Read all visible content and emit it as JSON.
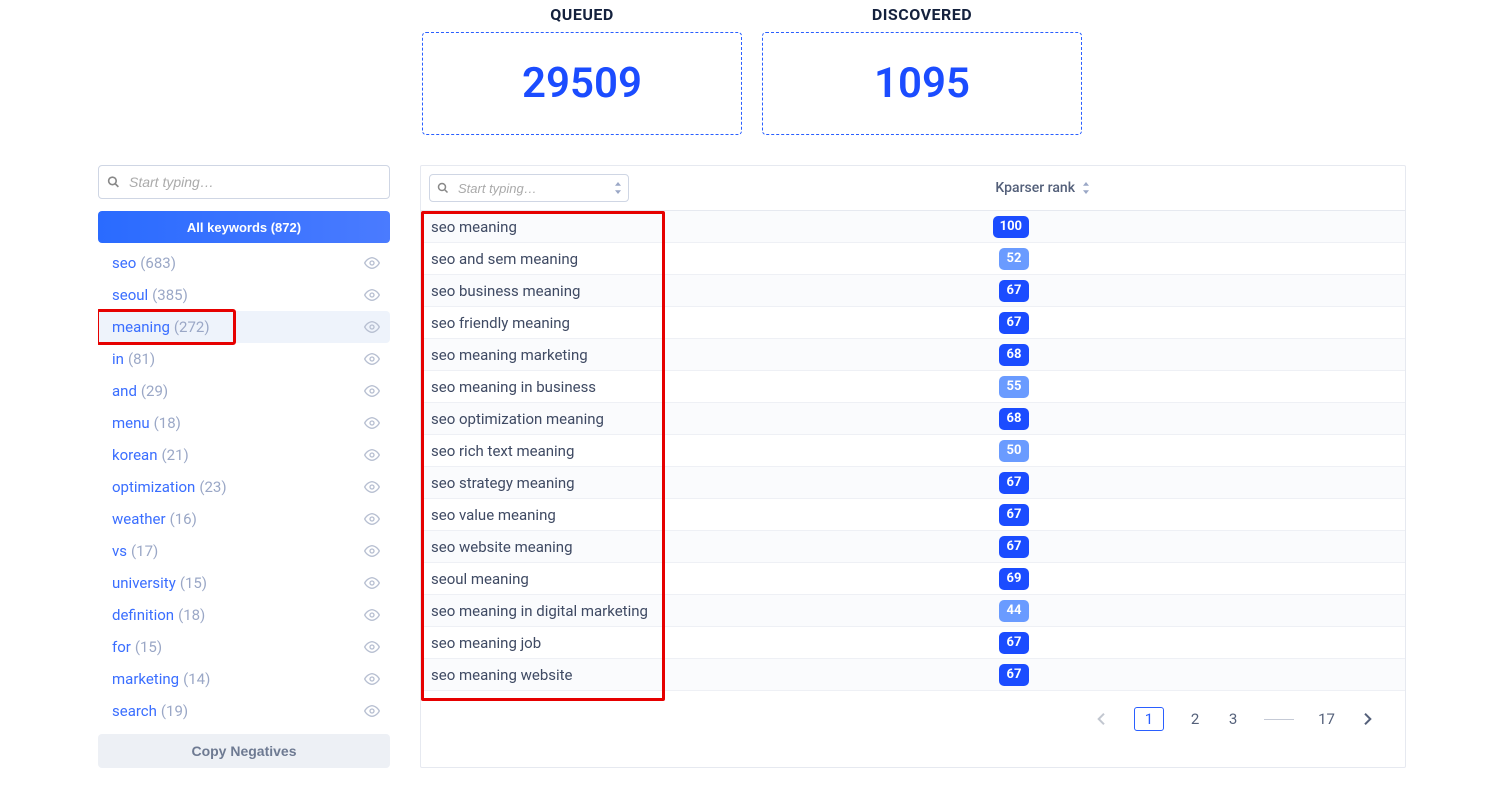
{
  "stats": {
    "queued_label": "QUEUED",
    "queued_value": "29509",
    "discovered_label": "DISCOVERED",
    "discovered_value": "1095"
  },
  "sidebar": {
    "search_placeholder": "Start typing…",
    "all_keywords_label": "All keywords (872)",
    "copy_negatives_label": "Copy Negatives",
    "items": [
      {
        "label": "seo",
        "count": "(683)",
        "selected": false,
        "highlighted": false
      },
      {
        "label": "seoul",
        "count": "(385)",
        "selected": false,
        "highlighted": false
      },
      {
        "label": "meaning",
        "count": "(272)",
        "selected": true,
        "highlighted": true
      },
      {
        "label": "in",
        "count": "(81)",
        "selected": false,
        "highlighted": false
      },
      {
        "label": "and",
        "count": "(29)",
        "selected": false,
        "highlighted": false
      },
      {
        "label": "menu",
        "count": "(18)",
        "selected": false,
        "highlighted": false
      },
      {
        "label": "korean",
        "count": "(21)",
        "selected": false,
        "highlighted": false
      },
      {
        "label": "optimization",
        "count": "(23)",
        "selected": false,
        "highlighted": false
      },
      {
        "label": "weather",
        "count": "(16)",
        "selected": false,
        "highlighted": false
      },
      {
        "label": "vs",
        "count": "(17)",
        "selected": false,
        "highlighted": false
      },
      {
        "label": "university",
        "count": "(15)",
        "selected": false,
        "highlighted": false
      },
      {
        "label": "definition",
        "count": "(18)",
        "selected": false,
        "highlighted": false
      },
      {
        "label": "for",
        "count": "(15)",
        "selected": false,
        "highlighted": false
      },
      {
        "label": "marketing",
        "count": "(14)",
        "selected": false,
        "highlighted": false
      },
      {
        "label": "search",
        "count": "(19)",
        "selected": false,
        "highlighted": false
      }
    ]
  },
  "table": {
    "search_placeholder": "Start typing…",
    "rank_header": "Kparser rank",
    "rows": [
      {
        "text": "seo meaning",
        "rank": "100",
        "strong": true
      },
      {
        "text": "seo and sem meaning",
        "rank": "52",
        "strong": false
      },
      {
        "text": "seo business meaning",
        "rank": "67",
        "strong": true
      },
      {
        "text": "seo friendly meaning",
        "rank": "67",
        "strong": true
      },
      {
        "text": "seo meaning marketing",
        "rank": "68",
        "strong": true
      },
      {
        "text": "seo meaning in business",
        "rank": "55",
        "strong": false
      },
      {
        "text": "seo optimization meaning",
        "rank": "68",
        "strong": true
      },
      {
        "text": "seo rich text meaning",
        "rank": "50",
        "strong": false
      },
      {
        "text": "seo strategy meaning",
        "rank": "67",
        "strong": true
      },
      {
        "text": "seo value meaning",
        "rank": "67",
        "strong": true
      },
      {
        "text": "seo website meaning",
        "rank": "67",
        "strong": true
      },
      {
        "text": "seoul meaning",
        "rank": "69",
        "strong": true
      },
      {
        "text": "seo meaning in digital marketing",
        "rank": "44",
        "strong": false
      },
      {
        "text": "seo meaning job",
        "rank": "67",
        "strong": true
      },
      {
        "text": "seo meaning website",
        "rank": "67",
        "strong": true
      }
    ]
  },
  "pagination": {
    "pages": [
      "1",
      "2",
      "3"
    ],
    "last": "17",
    "current": "1"
  }
}
